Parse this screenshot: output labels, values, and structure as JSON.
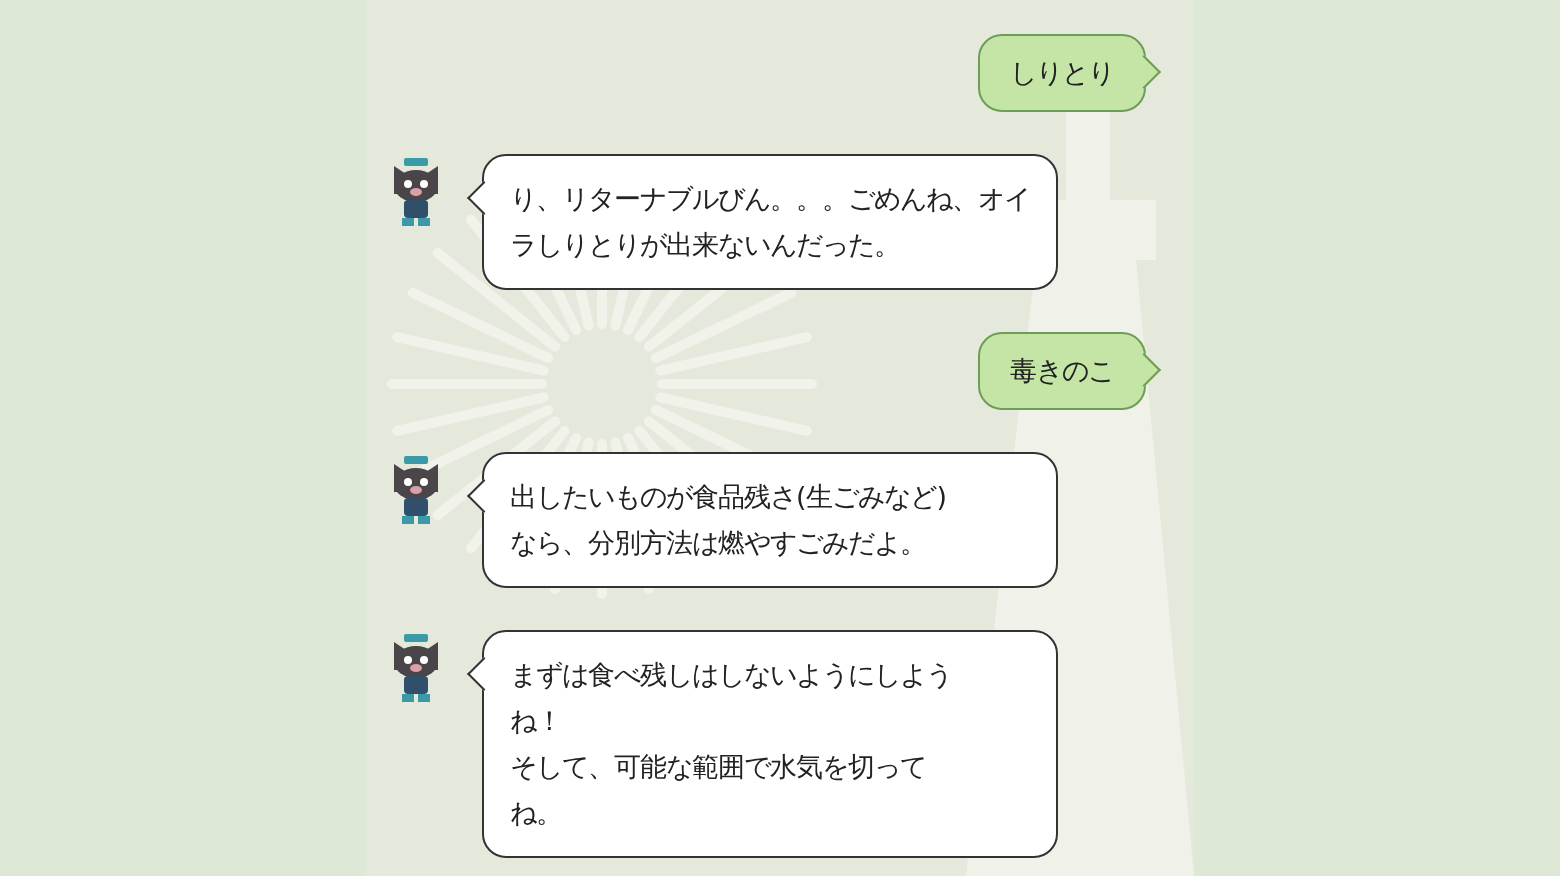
{
  "messages": [
    {
      "kind": "sent",
      "lines": [
        "しりとり"
      ]
    },
    {
      "kind": "received",
      "lines": [
        "り、リターナブルびん。。。ごめんね、オイ",
        "ラしりとりが出来ないんだった。"
      ]
    },
    {
      "kind": "sent",
      "lines": [
        "毒きのこ"
      ]
    },
    {
      "kind": "received",
      "lines": [
        "出したいものが食品残さ(生ごみなど)",
        "なら、分別方法は燃やすごみだよ。"
      ]
    },
    {
      "kind": "received",
      "lines": [
        "まずは食べ残しはしないようにしよう",
        "ね！",
        "そして、可能な範囲で水気を切って",
        "ね。"
      ]
    }
  ]
}
